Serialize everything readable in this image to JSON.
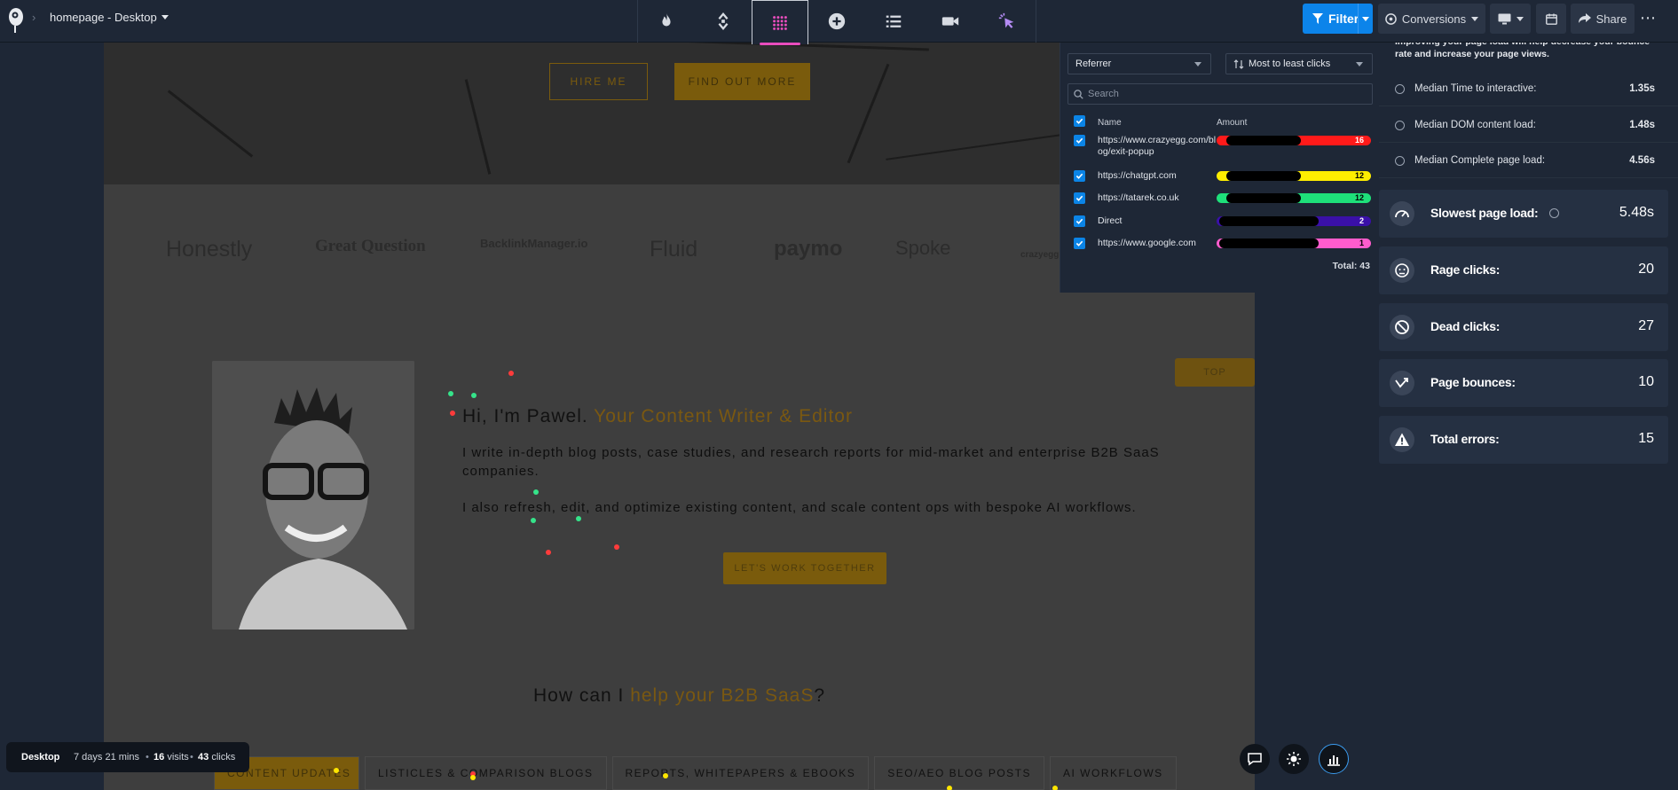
{
  "header": {
    "page_name": "homepage - Desktop",
    "filter_label": "Filter",
    "conversions_label": "Conversions",
    "share_label": "Share",
    "more_label": "⋯",
    "modes": [
      "flame-icon",
      "scroll-icon",
      "heatmap-dots-icon",
      "plus-circle-icon",
      "list-icon",
      "video-icon",
      "click-cursor-icon"
    ],
    "active_mode": "heatmap-dots-icon",
    "active_color": "#e94dbd"
  },
  "website": {
    "hero_buttons": {
      "hire": "HIRE ME",
      "find_out": "FIND OUT MORE"
    },
    "logos": [
      "Honestly",
      "Great Question",
      "BacklinkManager.io",
      "Fluid",
      "paymo",
      "Spoke",
      "crazyegg"
    ],
    "top_label": "TOP",
    "intro_title_plain": "Hi, I'm Pawel. ",
    "intro_title_accent": "Your Content Writer & Editor",
    "paragraph1": "I write in-depth blog posts, case studies, and research reports for mid-market and enterprise B2B SaaS companies.",
    "paragraph2": "I also refresh, edit, and optimize existing content, and scale content ops with bespoke AI workflows.",
    "cta": "LET'S WORK TOGETHER",
    "help_plain": "How can I ",
    "help_accent": "help your B2B SaaS",
    "help_end": "?",
    "services": [
      "CONTENT UPDATES",
      "LISTICLES & COMPARISON BLOGS",
      "REPORTS, WHITEPAPERS & EBOOKS",
      "SEO/AEO BLOG POSTS",
      "AI WORKFLOWS"
    ]
  },
  "referrer_panel": {
    "group_by": "Referrer",
    "sort": "Most to least clicks",
    "search_placeholder": "Search",
    "col_name": "Name",
    "col_amount": "Amount",
    "rows": [
      {
        "name": "https://www.crazyegg.com/blog/exit-popup",
        "amount": "16",
        "color": "#ff1a1a",
        "text_color": "#ffffff",
        "fill": 0.69
      },
      {
        "name": "https://chatgpt.com",
        "amount": "12",
        "color": "#ffee00",
        "text_color": "#000000",
        "fill": 0.69
      },
      {
        "name": "https://tatarek.co.uk",
        "amount": "12",
        "color": "#1ee07a",
        "text_color": "#000000",
        "fill": 0.69
      },
      {
        "name": "Direct",
        "amount": "2",
        "color": "#3a10a8",
        "text_color": "#ffffff",
        "fill": 0.92
      },
      {
        "name": "https://www.google.com",
        "amount": "1",
        "color": "#ff5ccd",
        "text_color": "#000000",
        "fill": 0.92
      }
    ],
    "total": "Total: 43"
  },
  "stats": {
    "note": "Improving your page load will help decrease your bounce rate and increase your page views.",
    "medians": [
      {
        "label": "Median Time to interactive:",
        "value": "1.35s"
      },
      {
        "label": "Median DOM content load:",
        "value": "1.48s"
      },
      {
        "label": "Median Complete page load:",
        "value": "4.56s"
      }
    ],
    "cards": [
      {
        "label": "Slowest page load:",
        "value": "5.48s",
        "icon": "gauge-icon"
      },
      {
        "label": "Rage clicks:",
        "value": "20",
        "icon": "angry-face-icon"
      },
      {
        "label": "Dead clicks:",
        "value": "27",
        "icon": "blocked-icon"
      },
      {
        "label": "Page bounces:",
        "value": "10",
        "icon": "bounce-arrow-icon"
      },
      {
        "label": "Total errors:",
        "value": "15",
        "icon": "warning-icon"
      }
    ]
  },
  "statusbar": {
    "device": "Desktop",
    "duration": "7 days 21 mins",
    "visits_count": "16",
    "visits_label": "visits",
    "clicks_count": "43",
    "clicks_label": "clicks"
  }
}
